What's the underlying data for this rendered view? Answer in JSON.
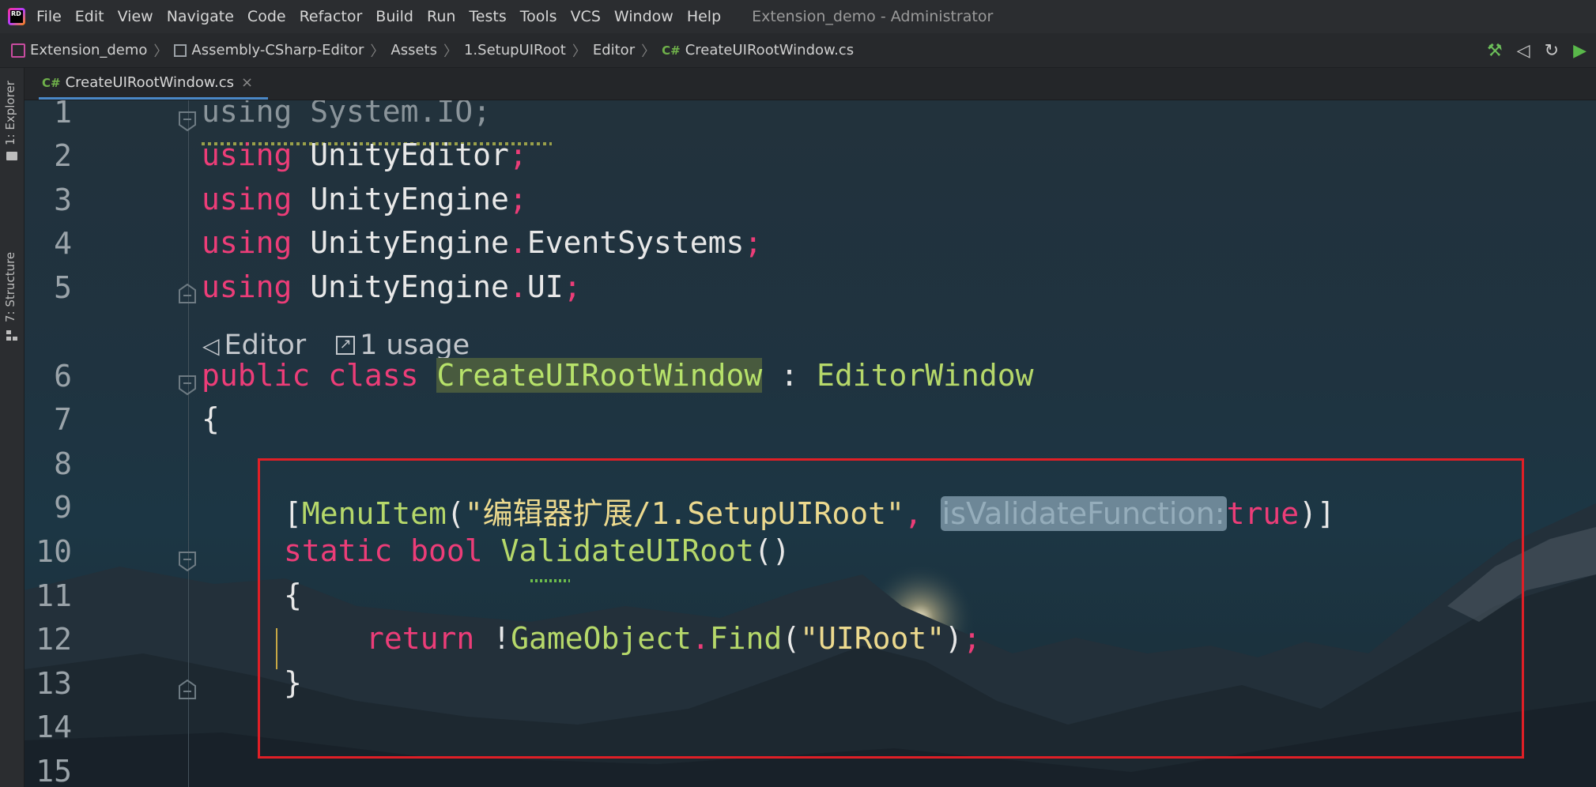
{
  "menu": {
    "items": [
      "File",
      "Edit",
      "View",
      "Navigate",
      "Code",
      "Refactor",
      "Build",
      "Run",
      "Tests",
      "Tools",
      "VCS",
      "Window",
      "Help"
    ],
    "window_title": "Extension_demo - Administrator"
  },
  "breadcrumb": {
    "project": "Extension_demo",
    "assembly": "Assembly-CSharp-Editor",
    "folder1": "Assets",
    "folder2": "1.SetupUIRoot",
    "folder3": "Editor",
    "file": "CreateUIRootWindow.cs"
  },
  "toolstrip": {
    "explorer": "1: Explorer",
    "structure": "7: Structure"
  },
  "tab": {
    "badge": "C#",
    "label": "CreateUIRootWindow.cs",
    "close": "×"
  },
  "editor": {
    "line_numbers": [
      "1",
      "2",
      "3",
      "4",
      "5",
      "6",
      "7",
      "8",
      "9",
      "10",
      "11",
      "12",
      "13",
      "14",
      "15"
    ],
    "codelens": {
      "editor_label": "Editor",
      "usages_label": "1 usage"
    },
    "line1": {
      "kw": "using",
      "rest": " System.IO;"
    },
    "line2": {
      "kw": "using",
      "ns": " UnityEditor",
      "semi": ";"
    },
    "line3": {
      "kw": "using",
      "ns": " UnityEngine",
      "semi": ";"
    },
    "line4": {
      "kw": "using",
      "ns1": " UnityEngine",
      "dot": ".",
      "ns2": "EventSystems",
      "semi": ";"
    },
    "line5": {
      "kw": "using",
      "ns1": " UnityEngine",
      "dot": ".",
      "ns2": "UI",
      "semi": ";"
    },
    "line6": {
      "kw1": "public",
      "kw2": "class",
      "name": "CreateUIRootWindow",
      "colon": ":",
      "base": "EditorWindow"
    },
    "line7": {
      "brace": "{"
    },
    "line9": {
      "open": "[",
      "attr": "MenuItem",
      "paren": "(",
      "str": "\"编辑器扩展/1.SetupUIRoot\"",
      "comma": ",",
      "hint": "isValidateFunction:",
      "val": "true",
      "close": ")]"
    },
    "line10": {
      "kw1": "static",
      "kw2": "bool",
      "name": "ValidateUIRoot",
      "parens": "()"
    },
    "line11": {
      "brace": "{"
    },
    "line12": {
      "kw": "return",
      "bang": "!",
      "type": "GameObject",
      "dot": ".",
      "method": "Find",
      "paren1": "(",
      "str": "\"UIRoot\"",
      "paren2": ")",
      "semi": ";"
    },
    "line13": {
      "brace": "}"
    }
  },
  "colors": {
    "keyword": "#ec3d78",
    "type": "#b6d86a",
    "string": "#ecd98e",
    "highlight_box": "#e01f26",
    "tab_underline": "#4a88c7"
  }
}
